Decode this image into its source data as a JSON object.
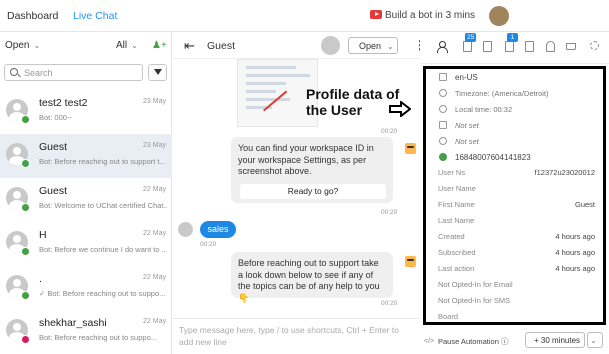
{
  "topbar": {
    "dashboard": "Dashboard",
    "live_chat": "Live Chat",
    "build_bot": "Build a bot in 3 mins"
  },
  "list": {
    "filter_open": "Open",
    "filter_all": "All",
    "search_placeholder": "Search",
    "conversations": [
      {
        "name": "test2 test2",
        "date": "23 May",
        "preview": "Bot: 000--",
        "channel_color": "#43a047"
      },
      {
        "name": "Guest",
        "date": "23 May",
        "preview": "Bot: Before reaching out to support t...",
        "channel_color": "#43a047"
      },
      {
        "name": "Guest",
        "date": "22 May",
        "preview": "Bot: Welcome to UChat certified Chat...",
        "channel_color": "#43a047"
      },
      {
        "name": "H",
        "date": "22 May",
        "preview": "Bot: Before we continue I do want to ...",
        "channel_color": "#43a047"
      },
      {
        "name": ".",
        "date": "22 May",
        "preview": "✓ Bot: Before reaching out to suppo...",
        "channel_color": "#43a047"
      },
      {
        "name": "shekhar_sashi",
        "date": "22 May",
        "preview": "Bot: Before reaching out to suppo...",
        "channel_color": "#d81b60"
      }
    ]
  },
  "chat": {
    "contact_name": "Guest",
    "status": "Open",
    "annotation": "Profile data of the User",
    "messages": [
      {
        "time": "00:20"
      },
      {
        "text": "You can find your workspace ID in your workspace Settings, as per screenshot above.",
        "button": "Ready to go?",
        "time": "00:20"
      },
      {
        "text": "sales",
        "time": "00:20"
      },
      {
        "text": "Before reaching out to support take a look down below to see if any of the topics can be of any help to you 👇",
        "time": "00:20"
      }
    ],
    "composer_placeholder": "Type message here, type / to use shortcuts, Ctrl + Enter to add new line"
  },
  "profile": {
    "tab_badges": [
      "25",
      "1"
    ],
    "locale": "en-US",
    "timezone": "Timezone: (America/Detroit)",
    "local_time": "Local time: 00:32",
    "email": "Not set",
    "phone": "Not set",
    "whatsapp": "16848007604141823",
    "fields": [
      {
        "label": "User Ns",
        "value": "f12372u23020012"
      },
      {
        "label": "User Name",
        "value": ""
      },
      {
        "label": "First Name",
        "value": "Guest"
      },
      {
        "label": "Last Name",
        "value": ""
      },
      {
        "label": "Created",
        "value": "4 hours ago"
      },
      {
        "label": "Subscribed",
        "value": "4 hours ago"
      },
      {
        "label": "Last action",
        "value": "4 hours ago"
      },
      {
        "label": "Not Opted-In for Email",
        "value": ""
      },
      {
        "label": "Not Opted-In for SMS",
        "value": ""
      },
      {
        "label": "Board",
        "value": ""
      }
    ],
    "pause_label": "Pause Automation",
    "pause_value": "+ 30 minutes",
    "code_icon": "</>"
  },
  "colors": {
    "accent": "#1e88e5",
    "whatsapp": "#43a047"
  },
  "icons": [
    "search-icon",
    "filter-icon",
    "add-user-icon",
    "back-arrow-icon",
    "kebab-icon",
    "person-icon",
    "bell-icon",
    "cart-icon",
    "gear-icon",
    "youtube-icon"
  ]
}
